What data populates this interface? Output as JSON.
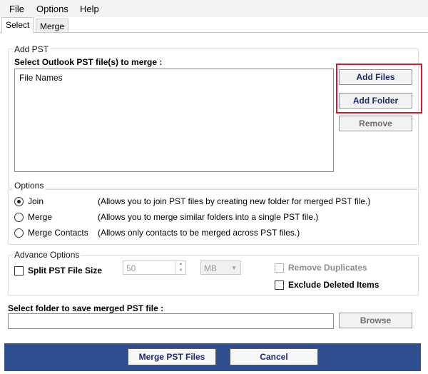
{
  "menu": {
    "file": "File",
    "options": "Options",
    "help": "Help"
  },
  "tabs": {
    "select": "Select",
    "merge": "Merge"
  },
  "add_pst": {
    "section_title": "Add PST",
    "prompt": "Select Outlook PST file(s) to merge :",
    "list_header": "File Names",
    "add_files": "Add Files",
    "add_folder": "Add Folder",
    "remove": "Remove",
    "highlight_color": "#e3132b"
  },
  "options": {
    "section_title": "Options",
    "items": [
      {
        "label": "Join",
        "description": "(Allows you to join PST files by creating new folder for merged PST file.)",
        "checked": true
      },
      {
        "label": "Merge",
        "description": "(Allows you to merge similar folders into a single PST file.)",
        "checked": false
      },
      {
        "label": "Merge Contacts",
        "description": "(Allows only contacts to be merged across PST files.)",
        "checked": false
      }
    ]
  },
  "advance": {
    "section_title": "Advance Options",
    "split_label": "Split PST File Size",
    "split_value": "50",
    "unit": "MB",
    "remove_duplicates": "Remove Duplicates",
    "exclude_deleted": "Exclude Deleted Items"
  },
  "save": {
    "prompt": "Select folder to save merged PST file :",
    "path": "",
    "browse": "Browse"
  },
  "footer": {
    "merge_button": "Merge PST Files",
    "cancel_button": "Cancel",
    "bar_color": "#2f4f8f"
  }
}
